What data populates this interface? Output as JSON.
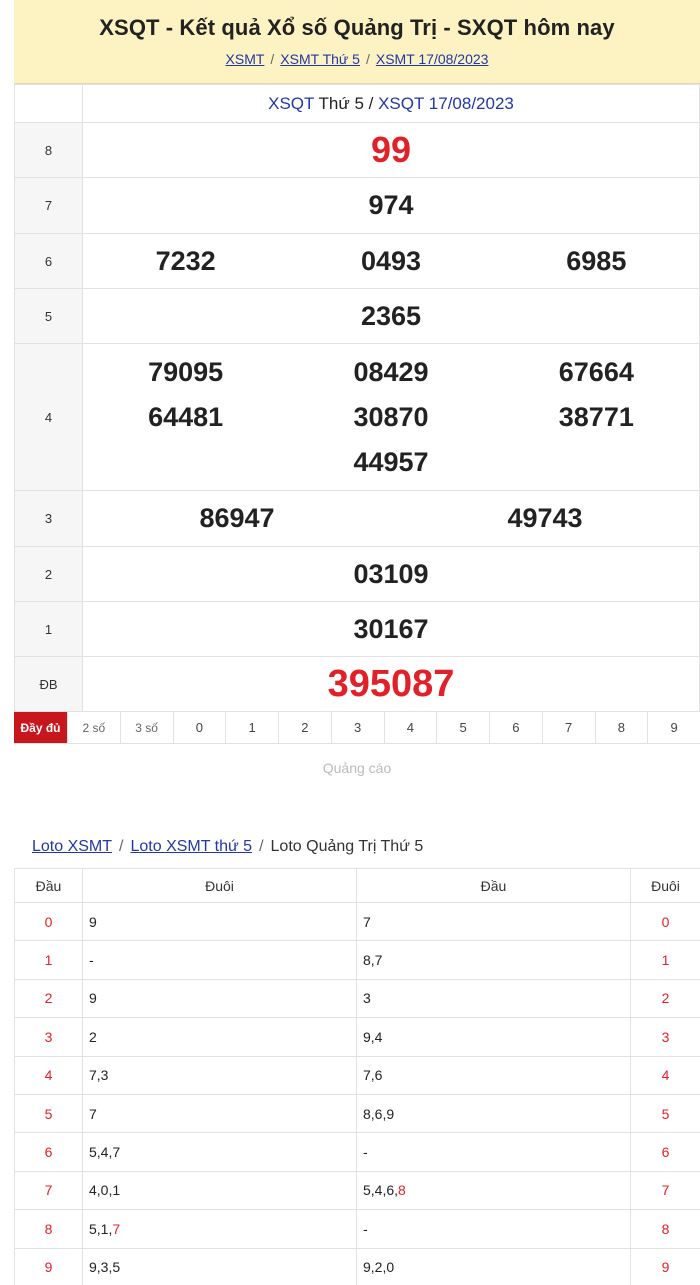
{
  "header": {
    "title": "XSQT - Kết quả Xổ số Quảng Trị - SXQT hôm nay",
    "breadcrumbs": [
      "XSMT",
      "XSMT Thứ 5",
      "XSMT 17/08/2023"
    ]
  },
  "results": {
    "caption": {
      "link1": "XSQT",
      "mid": " Thứ 5 / ",
      "link2": "XSQT 17/08/2023"
    },
    "rows": [
      {
        "label": "8",
        "values": [
          "99"
        ]
      },
      {
        "label": "7",
        "values": [
          "974"
        ]
      },
      {
        "label": "6",
        "values": [
          "7232",
          "0493",
          "6985"
        ]
      },
      {
        "label": "5",
        "values": [
          "2365"
        ]
      },
      {
        "label": "4",
        "values": [
          "79095",
          "08429",
          "67664",
          "64481",
          "30870",
          "38771",
          "44957"
        ]
      },
      {
        "label": "3",
        "values": [
          "86947",
          "49743"
        ]
      },
      {
        "label": "2",
        "values": [
          "03109"
        ]
      },
      {
        "label": "1",
        "values": [
          "30167"
        ]
      },
      {
        "label": "ĐB",
        "values": [
          "395087"
        ]
      }
    ]
  },
  "tabs": [
    "Đầy đủ",
    "2 số",
    "3 số",
    "0",
    "1",
    "2",
    "3",
    "4",
    "5",
    "6",
    "7",
    "8",
    "9"
  ],
  "ad_label": "Quảng cáo",
  "loto": {
    "breadcrumbs": [
      "Loto XSMT",
      "Loto XSMT thứ 5",
      "Loto Quảng Trị Thứ 5"
    ],
    "headers": [
      "Đầu",
      "Đuôi",
      "Đầu",
      "Đuôi"
    ],
    "rows": [
      {
        "head": "0",
        "tails": "9",
        "heads": "7",
        "tail": "0"
      },
      {
        "head": "1",
        "tails": "-",
        "heads": "8,7",
        "tail": "1"
      },
      {
        "head": "2",
        "tails": "9",
        "heads": "3",
        "tail": "2"
      },
      {
        "head": "3",
        "tails": "2",
        "heads": "9,4",
        "tail": "3"
      },
      {
        "head": "4",
        "tails": "7,3",
        "heads": "7,6",
        "tail": "4"
      },
      {
        "head": "5",
        "tails": "7",
        "heads": "8,6,9",
        "tail": "5"
      },
      {
        "head": "6",
        "tails": "5,4,7",
        "heads": "-",
        "tail": "6"
      },
      {
        "head": "7",
        "tails": "4,0,1",
        "heads": "5,4,6,",
        "heads_hl": "8",
        "tail": "7"
      },
      {
        "head": "8",
        "tails": "5,1,",
        "tails_hl": "7",
        "heads": "-",
        "tail": "8"
      },
      {
        "head": "9",
        "tails": "9,3,5",
        "heads": "9,2,0",
        "tail": "9"
      }
    ]
  },
  "colors": {
    "accent_red": "#e22027",
    "link_blue": "#2237a8",
    "header_bg": "#fcf2c2",
    "tab_active": "#c8161d"
  }
}
